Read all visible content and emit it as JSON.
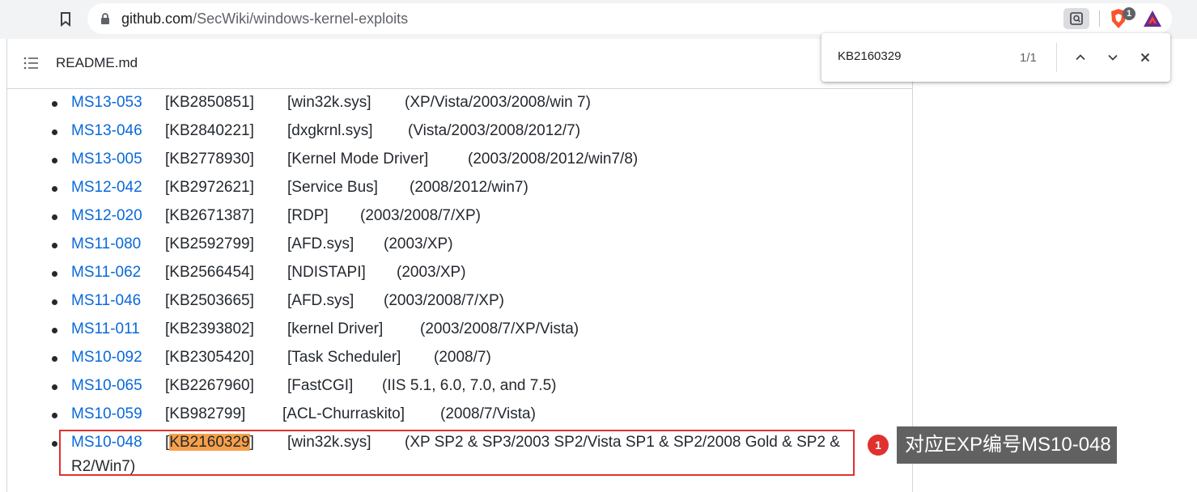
{
  "browser": {
    "url_host": "github.com",
    "url_path": "/SecWiki/windows-kernel-exploits",
    "brave_badge": "1"
  },
  "readme": {
    "title": "README.md"
  },
  "find_bar": {
    "query": "KB2160329",
    "count": "1/1"
  },
  "exploits": [
    {
      "ms": "MS13-053",
      "kb": "[KB2850851]",
      "component": "[win32k.sys]",
      "os": "(XP/Vista/2003/2008/win 7)"
    },
    {
      "ms": "MS13-046",
      "kb": "[KB2840221]",
      "component": "[dxgkrnl.sys]",
      "os": "(Vista/2003/2008/2012/7)"
    },
    {
      "ms": "MS13-005",
      "kb": "[KB2778930]",
      "component": "[Kernel Mode Driver]",
      "os": "(2003/2008/2012/win7/8)"
    },
    {
      "ms": "MS12-042",
      "kb": "[KB2972621]",
      "component": "[Service Bus]",
      "os": "(2008/2012/win7)"
    },
    {
      "ms": "MS12-020",
      "kb": "[KB2671387]",
      "component": "[RDP]",
      "os": "(2003/2008/7/XP)"
    },
    {
      "ms": "MS11-080",
      "kb": "[KB2592799]",
      "component": "[AFD.sys]",
      "os": "(2003/XP)"
    },
    {
      "ms": "MS11-062",
      "kb": "[KB2566454]",
      "component": "[NDISTAPI]",
      "os": "(2003/XP)"
    },
    {
      "ms": "MS11-046",
      "kb": "[KB2503665]",
      "component": "[AFD.sys]",
      "os": "(2003/2008/7/XP)"
    },
    {
      "ms": "MS11-011",
      "kb": "[KB2393802]",
      "component": "[kernel Driver]",
      "os": "(2003/2008/7/XP/Vista)"
    },
    {
      "ms": "MS10-092",
      "kb": "[KB2305420]",
      "component": "[Task Scheduler]",
      "os": "(2008/7)"
    },
    {
      "ms": "MS10-065",
      "kb": "[KB2267960]",
      "component": "[FastCGI]",
      "os": "(IIS 5.1, 6.0, 7.0, and 7.5)"
    },
    {
      "ms": "MS10-059",
      "kb": "[KB982799]",
      "component": "[ACL-Churraskito]",
      "os": "(2008/7/Vista)"
    }
  ],
  "highlighted": {
    "ms": "MS10-048",
    "kb_open": "[",
    "kb_match": "KB2160329",
    "kb_close": "]",
    "component": "[win32k.sys]",
    "os_line1": "(XP SP2 & SP3/2003 SP2/Vista SP1 & SP2/2008 Gold & SP2 &",
    "os_line2": "R2/Win7)"
  },
  "annotation": {
    "marker": "1",
    "text": "对应EXP编号MS10-048"
  },
  "colors": {
    "link": "#0969da",
    "highlight": "#f6a04a",
    "annotation_red": "#e0312f",
    "tooltip_bg": "#616161"
  }
}
